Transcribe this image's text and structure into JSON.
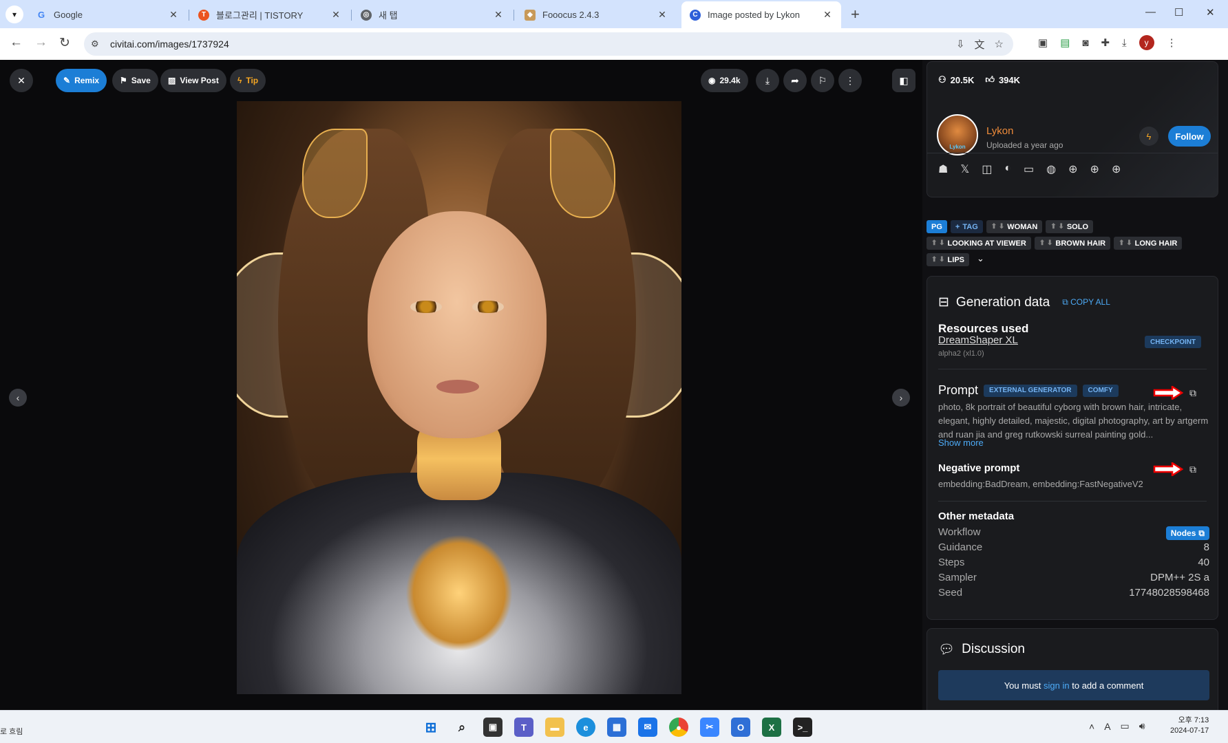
{
  "browser": {
    "tabs": [
      {
        "title": "Google",
        "fav": "G",
        "color": "#ffffff"
      },
      {
        "title": "블로그관리 | TISTORY",
        "fav": "T",
        "color": "#eb531f"
      },
      {
        "title": "새 탭",
        "fav": "",
        "color": "#5f6368"
      },
      {
        "title": "Fooocus 2.4.3",
        "fav": "",
        "color": "#c89a5a"
      },
      {
        "title": "Image posted by Lykon",
        "fav": "C",
        "color": "#2d5fd9"
      }
    ],
    "url": "civitai.com/images/1737924",
    "profile_initial": "y"
  },
  "toolbar": {
    "remix": "Remix",
    "save": "Save",
    "view_post": "View Post",
    "tip": "Tip",
    "views": "29.4k"
  },
  "profile": {
    "followers": "20.5K",
    "likes": "394K",
    "name": "Lykon",
    "uploaded": "Uploaded a year ago",
    "follow": "Follow",
    "avatar_text": "Lykon"
  },
  "tags": {
    "pg": "PG",
    "add_tag": "TAG",
    "items": [
      "WOMAN",
      "SOLO",
      "LOOKING AT VIEWER",
      "BROWN HAIR",
      "LONG HAIR",
      "LIPS"
    ]
  },
  "generation": {
    "title": "Generation data",
    "copy_all": "COPY ALL",
    "resources_title": "Resources used",
    "resource_name": "DreamShaper XL",
    "resource_version": "alpha2 (xl1.0)",
    "resource_type": "CHECKPOINT",
    "prompt_title": "Prompt",
    "badge_external": "EXTERNAL GENERATOR",
    "badge_comfy": "COMFY",
    "prompt_text": "photo, 8k portrait of beautiful cyborg with brown hair, intricate, elegant, highly detailed, majestic, digital photography, art by artgerm and ruan jia and greg rutkowski surreal painting gold...",
    "show_more": "Show more",
    "negative_title": "Negative prompt",
    "negative_text": "embedding:BadDream, embedding:FastNegativeV2",
    "other_title": "Other metadata",
    "workflow_label": "Workflow",
    "nodes": "Nodes",
    "guidance_label": "Guidance",
    "guidance": "8",
    "steps_label": "Steps",
    "steps": "40",
    "sampler_label": "Sampler",
    "sampler": "DPM++ 2S a",
    "seed_label": "Seed",
    "seed": "17748028598468"
  },
  "discussion": {
    "title": "Discussion",
    "before": "You must",
    "link": "sign in",
    "after": "to add a comment"
  },
  "taskbar": {
    "left_text": "로 흐림",
    "time": "오후 7:13",
    "date": "2024-07-17"
  }
}
